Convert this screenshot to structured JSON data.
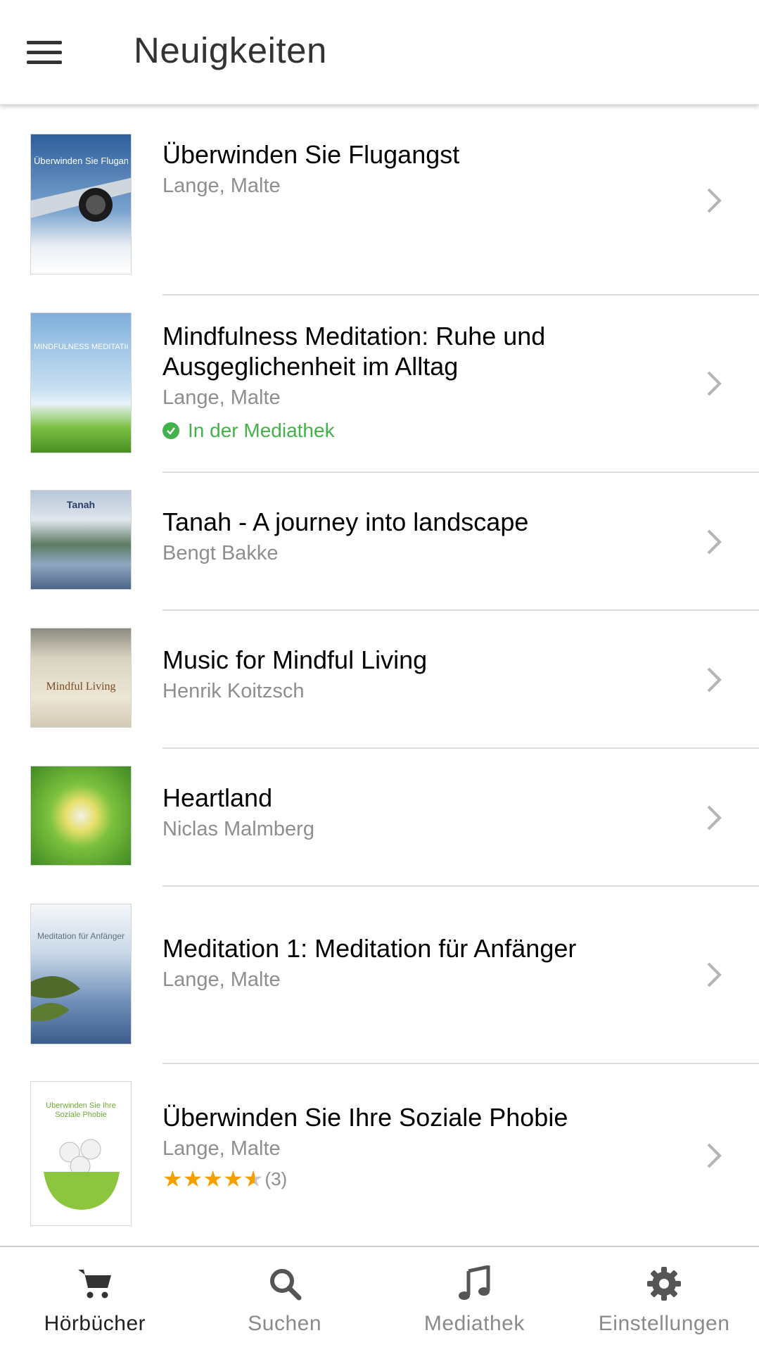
{
  "header": {
    "title": "Neuigkeiten",
    "menu_icon": "hamburger-menu-icon"
  },
  "items": [
    {
      "title": "Überwinden Sie Flugangst",
      "author": "Lange, Malte",
      "cover_text": "Überwinden Sie Flugangst"
    },
    {
      "title": "Mindfulness Meditation: Ruhe und Ausgeglichenheit im Alltag",
      "author": "Lange, Malte",
      "library_status": "In der Mediathek",
      "cover_text": "MINDFULNESS MEDITATION"
    },
    {
      "title": "Tanah - A journey into landscape",
      "author": "Bengt Bakke",
      "cover_text": "Tanah"
    },
    {
      "title": "Music for Mindful Living",
      "author": "Henrik Koitzsch",
      "cover_text": "Mindful Living"
    },
    {
      "title": "Heartland",
      "author": "Niclas Malmberg"
    },
    {
      "title": "Meditation 1: Meditation für Anfänger",
      "author": "Lange, Malte",
      "cover_text": "Meditation für Anfänger"
    },
    {
      "title": "Überwinden Sie Ihre Soziale Phobie",
      "author": "Lange, Malte",
      "rating": 4.5,
      "rating_count": "(3)",
      "cover_text": "Überwinden Sie Ihre Soziale Phobie"
    }
  ],
  "tabs": [
    {
      "label": "Hörbücher",
      "icon": "cart-icon",
      "active": true
    },
    {
      "label": "Suchen",
      "icon": "search-icon",
      "active": false
    },
    {
      "label": "Mediathek",
      "icon": "music-note-icon",
      "active": false
    },
    {
      "label": "Einstellungen",
      "icon": "gear-icon",
      "active": false
    }
  ],
  "colors": {
    "accent_green": "#43b24a",
    "star": "#f3a000",
    "secondary_text": "#8e8e8e"
  }
}
